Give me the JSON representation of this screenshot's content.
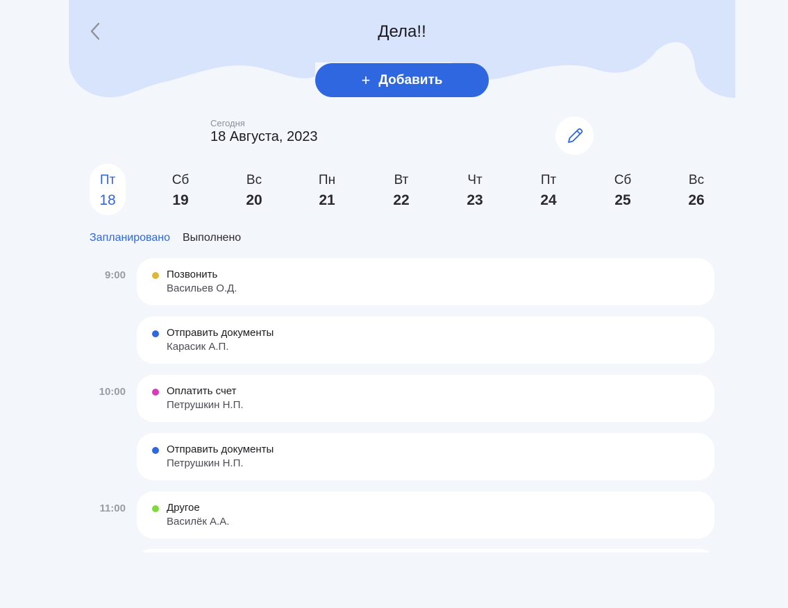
{
  "header": {
    "title": "Дела!!",
    "back_icon": "chevron-left-icon",
    "add_label": "Добавить",
    "add_icon": "plus-icon"
  },
  "today": {
    "caption": "Сегодня",
    "date": "18 Августа, 2023",
    "edit_icon": "pencil-icon"
  },
  "days": [
    {
      "dow": "Пт",
      "num": "18",
      "selected": true
    },
    {
      "dow": "Сб",
      "num": "19"
    },
    {
      "dow": "Вс",
      "num": "20"
    },
    {
      "dow": "Пн",
      "num": "21"
    },
    {
      "dow": "Вт",
      "num": "22"
    },
    {
      "dow": "Чт",
      "num": "23"
    },
    {
      "dow": "Пт",
      "num": "24"
    },
    {
      "dow": "Сб",
      "num": "25"
    },
    {
      "dow": "Вс",
      "num": "26"
    }
  ],
  "tabs": [
    {
      "label": "Запланировано",
      "active": true
    },
    {
      "label": "Выполнено",
      "active": false
    }
  ],
  "times": [
    "9:00",
    "10:00",
    "11:00"
  ],
  "tasks": [
    {
      "title": "Позвонить",
      "person": "Васильев О.Д.",
      "color": "#e0b53a"
    },
    {
      "title": "Отправить документы",
      "person": "Карасик А.П.",
      "color": "#2f67e0"
    },
    {
      "title": "Оплатить счет",
      "person": "Петрушкин Н.П.",
      "color": "#d93bb8"
    },
    {
      "title": "Отправить документы",
      "person": "Петрушкин Н.П.",
      "color": "#2f67e0"
    },
    {
      "title": "Другое",
      "person": "Василёк А.А.",
      "color": "#7ddb3b"
    }
  ],
  "colors": {
    "accent": "#2f67e0",
    "header_wave": "#d8e4fc",
    "background": "#f3f6fb"
  }
}
